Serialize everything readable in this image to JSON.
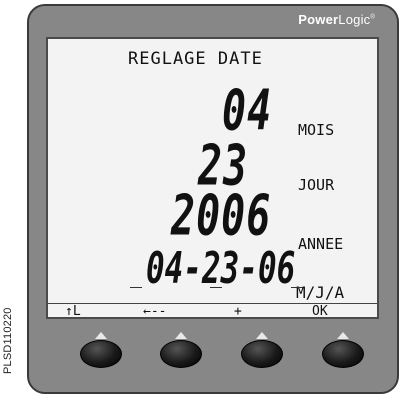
{
  "caption": "PLSD110220",
  "brand": {
    "bold": "Power",
    "light": "Logic",
    "mark": "®"
  },
  "screen": {
    "title": "REGLAGE DATE",
    "month_value": "04",
    "month_label": "MOIS",
    "day_value": "23",
    "day_label": "JOUR",
    "year_value": "2006",
    "year_label": "ANNEE",
    "date_value": "04-23-06",
    "date_format_label": "M/J/A"
  },
  "softkeys": {
    "key1": "↑L",
    "key2": "←--",
    "key3": "+",
    "key4": "OK"
  },
  "colors": {
    "bezel": "#878787",
    "screen": "#f3f3f3",
    "button": "#1a1a1a"
  }
}
